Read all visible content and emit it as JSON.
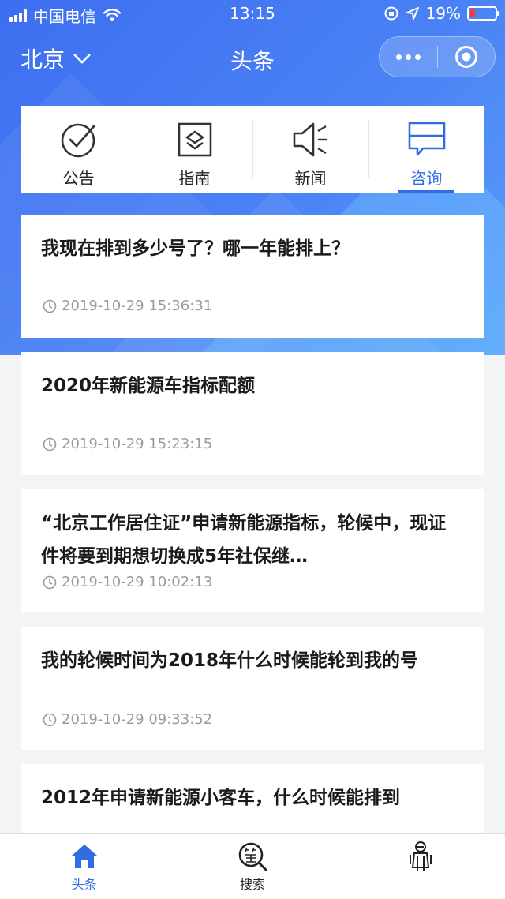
{
  "status_bar": {
    "carrier": "中国电信",
    "time": "13:15",
    "battery": "19%"
  },
  "nav": {
    "city": "北京",
    "title": "头条"
  },
  "tabs": [
    {
      "label": "公告",
      "icon": "check-circle-icon",
      "active": false
    },
    {
      "label": "指南",
      "icon": "layers-icon",
      "active": false
    },
    {
      "label": "新闻",
      "icon": "speaker-icon",
      "active": false
    },
    {
      "label": "咨询",
      "icon": "chat-icon",
      "active": true
    }
  ],
  "posts": [
    {
      "title": "我现在排到多少号了？哪一年能排上？",
      "time": "2019-10-29 15:36:31"
    },
    {
      "title": "2020年新能源车指标配额",
      "time": "2019-10-29 15:23:15"
    },
    {
      "title": "“北京工作居住证”申请新能源指标，轮候中，现证件将要到期想切换成5年社保继…",
      "time": "2019-10-29 10:02:13"
    },
    {
      "title": "我的轮候时间为2018年什么时候能轮到我的号",
      "time": "2019-10-29 09:33:52"
    },
    {
      "title": "2012年申请新能源小客车，什么时候能排到",
      "time": ""
    }
  ],
  "tabbar": [
    {
      "label": "头条",
      "icon": "home-icon",
      "active": true
    },
    {
      "label": "搜索",
      "icon": "search-sign-icon",
      "active": false
    },
    {
      "label": "",
      "icon": "robot-icon",
      "active": false
    }
  ],
  "colors": {
    "primary": "#2f6de0",
    "hero_start": "#3d6ef0",
    "hero_end": "#5aa0fa",
    "meta_text": "#9b9b9b"
  }
}
